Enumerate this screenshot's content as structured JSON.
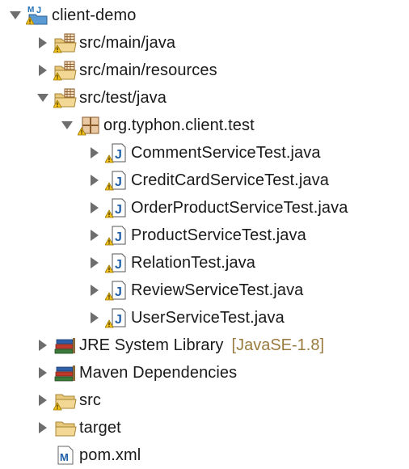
{
  "project": {
    "name": "client-demo",
    "icon": "maven-java-project-icon-warning",
    "expanded": true
  },
  "nodes": {
    "src_main_java": {
      "label": "src/main/java",
      "icon": "source-folder-icon-warning",
      "expanded": false
    },
    "src_main_resources": {
      "label": "src/main/resources",
      "icon": "source-folder-icon-warning",
      "expanded": false
    },
    "src_test_java": {
      "label": "src/test/java",
      "icon": "source-folder-icon-warning",
      "expanded": true
    },
    "package": {
      "label": "org.typhon.client.test",
      "icon": "package-icon-warning",
      "expanded": true
    },
    "files": [
      {
        "label": "CommentServiceTest.java",
        "icon": "java-file-icon-warning"
      },
      {
        "label": "CreditCardServiceTest.java",
        "icon": "java-file-icon-warning"
      },
      {
        "label": "OrderProductServiceTest.java",
        "icon": "java-file-icon-warning"
      },
      {
        "label": "ProductServiceTest.java",
        "icon": "java-file-icon-warning"
      },
      {
        "label": "RelationTest.java",
        "icon": "java-file-icon-warning"
      },
      {
        "label": "ReviewServiceTest.java",
        "icon": "java-file-icon-warning"
      },
      {
        "label": "UserServiceTest.java",
        "icon": "java-file-icon-warning"
      }
    ],
    "jre": {
      "label": "JRE System Library",
      "decoration": "[JavaSE-1.8]",
      "icon": "library-icon"
    },
    "maven": {
      "label": "Maven Dependencies",
      "icon": "library-icon"
    },
    "src": {
      "label": "src",
      "icon": "folder-icon-warning"
    },
    "target": {
      "label": "target",
      "icon": "folder-icon"
    },
    "pom": {
      "label": "pom.xml",
      "icon": "maven-pom-icon"
    }
  },
  "colors": {
    "decoration": "#9a7b3f",
    "twisty": "#6e6e6e",
    "folder": "#e8c87a",
    "warning": "#f4c21b"
  }
}
